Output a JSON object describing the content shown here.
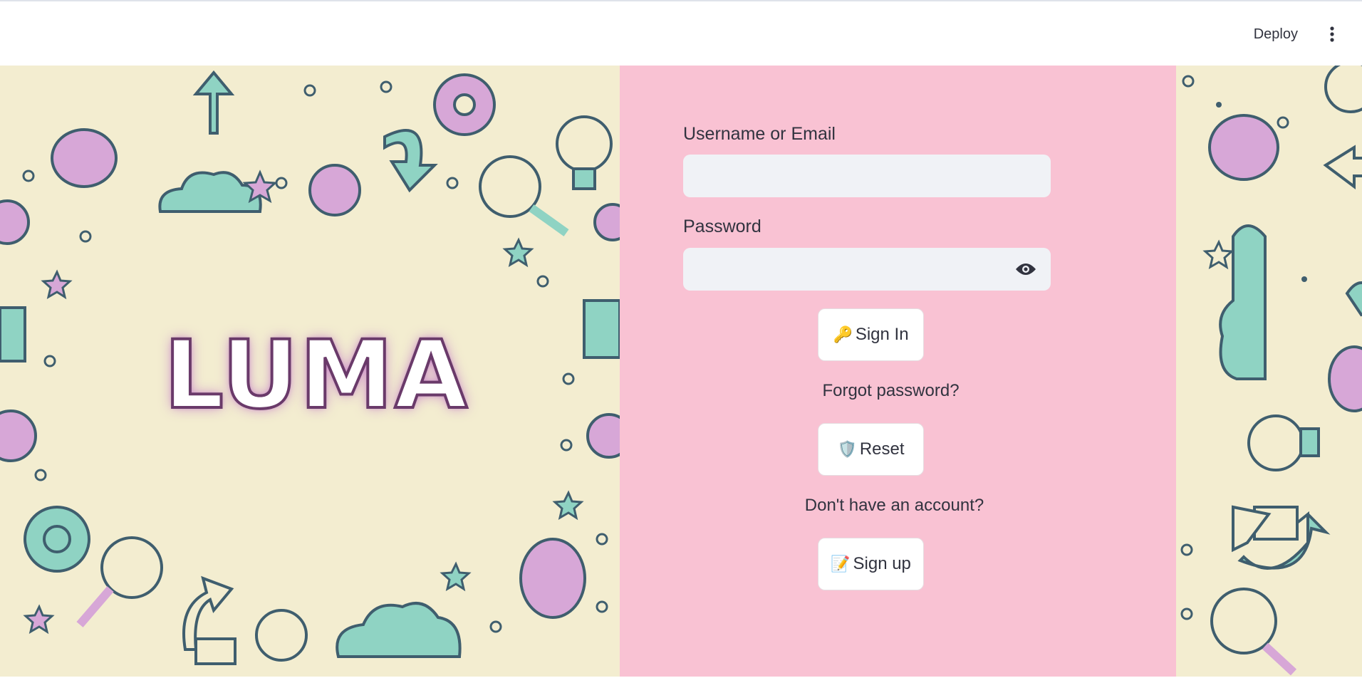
{
  "header": {
    "deploy_label": "Deploy",
    "menu_icon": "vertical-ellipsis-icon"
  },
  "branding": {
    "logo_text": "LUMA"
  },
  "login_form": {
    "username_label": "Username or Email",
    "username_value": "",
    "password_label": "Password",
    "password_value": "",
    "password_toggle_icon": "eye-icon",
    "sign_in": {
      "emoji": "🔑",
      "label": "Sign In"
    },
    "forgot_text": "Forgot password?",
    "reset": {
      "emoji": "🛡️",
      "label": "Reset"
    },
    "no_account_text": "Don't have an account?",
    "sign_up": {
      "emoji": "📝",
      "label": "Sign up"
    }
  },
  "colors": {
    "form_background": "#f9c2d3",
    "doodle_background": "#f3edd0",
    "input_background": "#f0f2f6",
    "text": "#31333f",
    "doodle_teal": "#8fd3c3",
    "doodle_purple": "#d7a7d7",
    "doodle_outline": "#3f5e6e"
  }
}
